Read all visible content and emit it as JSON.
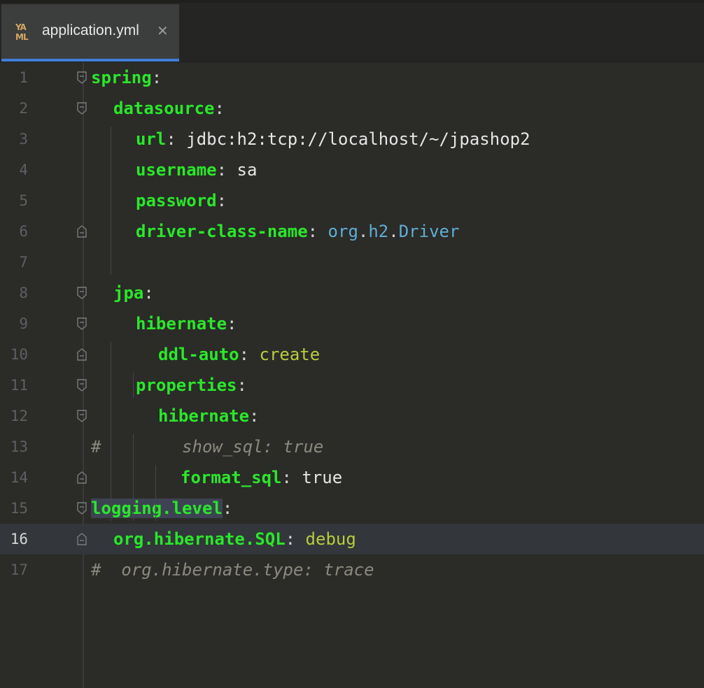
{
  "tab": {
    "icon_text": "YA\nML",
    "title": "application.yml",
    "close_glyph": "✕"
  },
  "lines": [
    {
      "num": "1",
      "parts": [
        [
          "key",
          "spring"
        ],
        [
          "colon",
          ":"
        ]
      ]
    },
    {
      "num": "2",
      "parts": [
        [
          "key",
          "datasource"
        ],
        [
          "colon",
          ":"
        ]
      ]
    },
    {
      "num": "3",
      "parts": [
        [
          "key",
          "url"
        ],
        [
          "colon",
          ": "
        ],
        [
          "plain",
          "jdbc:h2:tcp://localhost/~/jpashop2"
        ]
      ]
    },
    {
      "num": "4",
      "parts": [
        [
          "key",
          "username"
        ],
        [
          "colon",
          ": "
        ],
        [
          "plain",
          "sa"
        ]
      ]
    },
    {
      "num": "5",
      "parts": [
        [
          "key",
          "password"
        ],
        [
          "colon",
          ":"
        ]
      ]
    },
    {
      "num": "6",
      "parts": [
        [
          "key",
          "driver-class-name"
        ],
        [
          "colon",
          ": "
        ],
        [
          "blue",
          "org"
        ],
        [
          "colon",
          "."
        ],
        [
          "blue",
          "h2"
        ],
        [
          "colon",
          "."
        ],
        [
          "blue",
          "Driver"
        ]
      ]
    },
    {
      "num": "7",
      "parts": []
    },
    {
      "num": "8",
      "parts": [
        [
          "key",
          "jpa"
        ],
        [
          "colon",
          ":"
        ]
      ]
    },
    {
      "num": "9",
      "parts": [
        [
          "key",
          "hibernate"
        ],
        [
          "colon",
          ":"
        ]
      ]
    },
    {
      "num": "10",
      "parts": [
        [
          "key",
          "ddl-auto"
        ],
        [
          "colon",
          ": "
        ],
        [
          "lime",
          "create"
        ]
      ]
    },
    {
      "num": "11",
      "parts": [
        [
          "key",
          "properties"
        ],
        [
          "colon",
          ":"
        ]
      ]
    },
    {
      "num": "12",
      "parts": [
        [
          "key",
          "hibernate"
        ],
        [
          "colon",
          ":"
        ]
      ]
    },
    {
      "num": "13",
      "parts": [
        [
          "hash",
          "#"
        ],
        [
          "comment",
          "        show_sql: true"
        ]
      ]
    },
    {
      "num": "14",
      "parts": [
        [
          "key",
          "format_sql"
        ],
        [
          "colon",
          ": "
        ],
        [
          "plain",
          "true"
        ]
      ]
    },
    {
      "num": "15",
      "parts": [
        [
          "key hl",
          "logging.level"
        ],
        [
          "colon",
          ":"
        ]
      ]
    },
    {
      "num": "16",
      "parts": [
        [
          "key",
          "org.hibernate.SQL"
        ],
        [
          "colon",
          ": "
        ],
        [
          "lime",
          "debug"
        ]
      ]
    },
    {
      "num": "17",
      "parts": [
        [
          "hash",
          "#"
        ],
        [
          "comment",
          "  org.hibernate.type: trace"
        ]
      ]
    }
  ]
}
